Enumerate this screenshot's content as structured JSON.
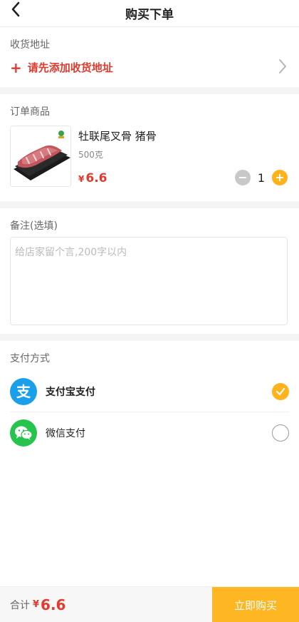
{
  "header": {
    "title": "购买下单",
    "back_icon": "chevron-left-icon"
  },
  "address": {
    "section_label": "收货地址",
    "add_text": "请先添加收货地址",
    "add_icon": "plus-icon",
    "chevron_icon": "chevron-right-icon"
  },
  "order": {
    "section_label": "订单商品",
    "item": {
      "name": "牡联尾叉骨 猪骨",
      "spec": "500克",
      "currency": "¥",
      "price": "6.6",
      "quantity": "1",
      "minus_label": "−",
      "plus_label": "+"
    }
  },
  "note": {
    "section_label": "备注(选填)",
    "placeholder": "给店家留个言,200字以内",
    "value": ""
  },
  "payment": {
    "section_label": "支付方式",
    "methods": [
      {
        "name": "支付宝支付",
        "icon": "alipay-icon",
        "selected": true,
        "logo_glyph": "支"
      },
      {
        "name": "微信支付",
        "icon": "wechat-icon",
        "selected": false
      }
    ]
  },
  "footer": {
    "total_label": "合计",
    "currency": "¥",
    "total": "6.6",
    "buy_label": "立即购买"
  },
  "colors": {
    "accent": "#ffb21a",
    "price_red": "#e23a2d",
    "alipay_blue": "#1aa0ea",
    "wechat_green": "#26c34d"
  }
}
